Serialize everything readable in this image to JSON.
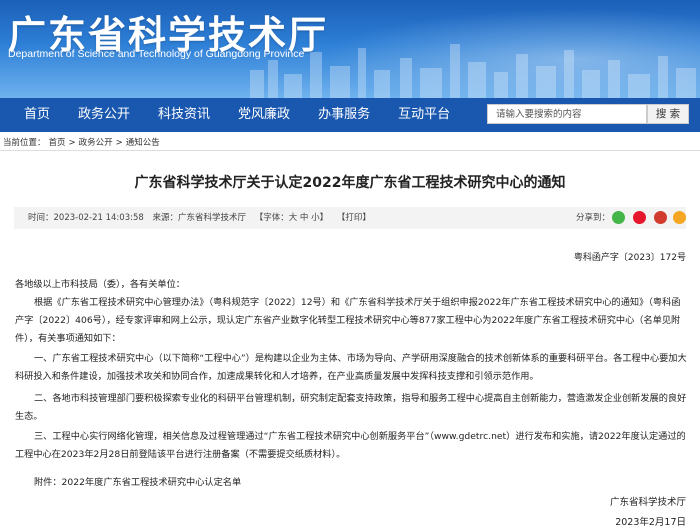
{
  "header": {
    "title": "广东省科学技术厅",
    "subtitle": "Department of Science and Technology of Guangdong Province"
  },
  "nav": {
    "items": [
      "首页",
      "政务公开",
      "科技资讯",
      "党风廉政",
      "办事服务",
      "互动平台"
    ],
    "search_placeholder": "请输入要搜索的内容",
    "search_button": "搜 索"
  },
  "breadcrumb": {
    "label": "当前位置：",
    "items": [
      "首页",
      "政务公开",
      "通知公告"
    ],
    "sep": ">"
  },
  "article": {
    "title": "广东省科学技术厅关于认定2022年度广东省工程技术研究中心的通知",
    "meta": {
      "time": "时间：2023-02-21 14:03:58",
      "source": "来源：广东省科学技术厅",
      "font": "【字体：大  中  小】",
      "print": "【打印】",
      "share": "分享到："
    },
    "doc_no": "粤科函产字〔2023〕172号",
    "salutation": "各地级以上市科技局（委），各有关单位：",
    "paragraphs": [
      "根据《广东省工程技术研究中心管理办法》（粤科规范字〔2022〕12号）和《广东省科学技术厅关于组织申报2022年广东省工程技术研究中心的通知》（粤科函产字〔2022〕406号），经专家评审和网上公示，现认定广东省产业数字化转型工程技术研究中心等877家工程中心为2022年度广东省工程技术研究中心（名单见附件），有关事项通知如下：",
      "一、广东省工程技术研究中心（以下简称“工程中心”）是构建以企业为主体、市场为导向、产学研用深度融合的技术创新体系的重要科研平台。各工程中心要加大科研投入和条件建设，加强技术攻关和协同合作，加速成果转化和人才培养，在产业高质量发展中发挥科技支撑和引领示范作用。",
      "二、各地市科技管理部门要积极探索专业化的科研平台管理机制，研究制定配套支持政策，指导和服务工程中心提高自主创新能力，营造激发企业创新发展的良好生态。",
      "三、工程中心实行网络化管理，相关信息及过程管理通过“广东省工程技术研究中心创新服务平台”（www.gdetrc.net）进行发布和实施，请2022年度认定通过的工程中心在2023年2月28日前登陆该平台进行注册备案（不需要提交纸质材料）。"
    ],
    "attachment": "附件：2022年度广东省工程技术研究中心认定名单",
    "signature": "广东省科学技术厅",
    "date": "2023年2月17日"
  },
  "colors": {
    "nav_bg": "#1a58b0",
    "banner_top": "#1b5fb8",
    "share_wechat": "#44b549",
    "share_weibo": "#e6162d",
    "share_qq": "#f5a623"
  }
}
